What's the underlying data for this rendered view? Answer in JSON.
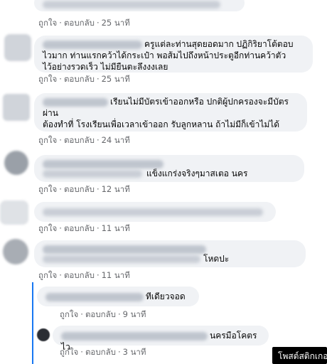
{
  "comments": [
    {
      "like": "ถูกใจ",
      "sep": "·",
      "reply": "ตอบกลับ",
      "time": "25 นาที",
      "text": ""
    },
    {
      "like": "ถูกใจ",
      "sep": "·",
      "reply": "ตอบกลับ",
      "time": "25 นาที",
      "text_line1": "ครูแต่ละท่านสุดยอดมาก ปฏิกิริยาโต้ตอบ",
      "text_line2": "ไวมาก ท่านแรกคว้าได้กระเป๋า พอส้มไปถึงหน้าประตูอีกท่านคว้าตัว",
      "text_line3": "ไว้อย่างรวดเร็ว ไม่มียืนตะลึงงงเลย"
    },
    {
      "like": "ถูกใจ",
      "sep": "·",
      "reply": "ตอบกลับ",
      "time": "24 นาที",
      "text_line1": "เรียนไม่มีบัตรเข้าออกหรือ ปกติผู้ปกครองจะมีบัตร",
      "text_line2": "ผ่าน",
      "text_line3": "ต้องทำที่ โรงเรียนเพื่อเวลาเข้าออก รับลูกหลาน ถ้าไม่มีก็เข้าไม่ได้"
    },
    {
      "like": "ถูกใจ",
      "sep": "·",
      "reply": "ตอบกลับ",
      "time": "12 นาที",
      "text_line1": "แข็งแกร่งจริงๆมาสเตอ นคร"
    },
    {
      "like": "ถูกใจ",
      "sep": "·",
      "reply": "ตอบกลับ",
      "time": "11 นาที",
      "text": ""
    },
    {
      "like": "ถูกใจ",
      "sep": "·",
      "reply": "ตอบกลับ",
      "time": "11 นาที",
      "text_line1": "โหดปะ"
    }
  ],
  "replies": [
    {
      "like": "ถูกใจ",
      "sep": "·",
      "reply": "ตอบกลับ",
      "time": "9 นาที",
      "text_line1": "ทีเดียวจอด"
    },
    {
      "like": "ถูกใจ",
      "sep": "·",
      "reply": "ตอบกลับ",
      "time": "3 นาที",
      "text_line1": "นครมือโคตรไว"
    }
  ],
  "tooltip": {
    "label": "โพสต์สติกเกอ"
  }
}
